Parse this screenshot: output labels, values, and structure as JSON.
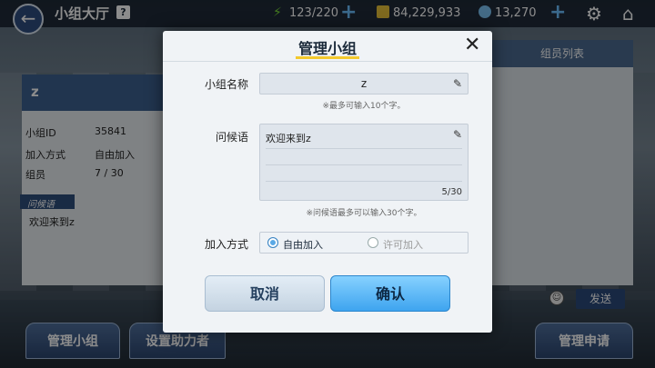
{
  "header": {
    "title": "小组大厅",
    "help": "?",
    "energy": "123/220",
    "coins": "84,229,933",
    "gems": "13,270"
  },
  "group_info": {
    "name": "z",
    "id_label": "小组ID",
    "id_value": "35841",
    "join_label": "加入方式",
    "join_value": "自由加入",
    "member_label": "组员",
    "member_value": "7 / 30",
    "greeting_tag": "问候语",
    "greeting_text": "欢迎来到z"
  },
  "member_panel": {
    "title": "组员列表",
    "send_label": "发送"
  },
  "bottom": {
    "manage_group": "管理小组",
    "set_helper": "设置助力者",
    "manage_requests": "管理申请"
  },
  "modal": {
    "title": "管理小组",
    "name_label": "小组名称",
    "name_value": "z",
    "name_note": "※最多可输入10个字。",
    "greeting_label": "问候语",
    "greeting_value": "欢迎来到z",
    "greeting_count": "5/30",
    "greeting_note": "※问候语最多可以输入30个字。",
    "join_label": "加入方式",
    "join_options": [
      "自由加入",
      "许可加入"
    ],
    "join_selected": "自由加入",
    "cancel": "取消",
    "confirm": "确认"
  },
  "colors": {
    "accent": "#3ea4ef",
    "title_underline": "#f3c92d"
  }
}
